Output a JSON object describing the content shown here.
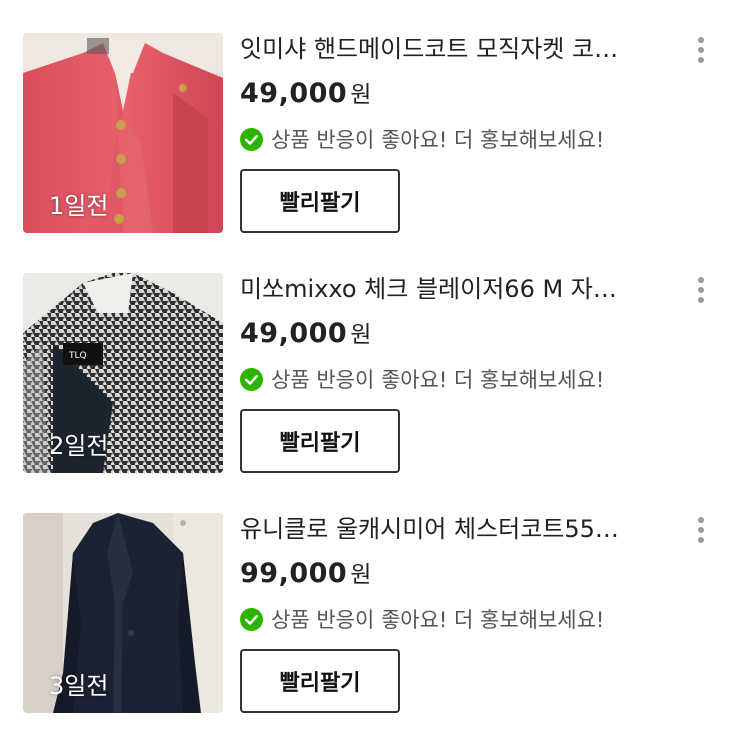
{
  "products": [
    {
      "title": "잇미샤 핸드메이드코트 모직자켓 코…",
      "price": "49,000",
      "currency": "원",
      "posted": "1일전",
      "status": "상품 반응이 좋아요! 더 홍보해보세요!",
      "action_label": "빨리팔기",
      "thumbnail": "pink-coat-photo"
    },
    {
      "title": "미쏘mixxo 체크 블레이저66 M 자…",
      "price": "49,000",
      "currency": "원",
      "posted": "2일전",
      "status": "상품 반응이 좋아요! 더 홍보해보세요!",
      "action_label": "빨리팔기",
      "thumbnail": "houndstooth-blazer-photo"
    },
    {
      "title": "유니클로 울캐시미어 체스터코트55…",
      "price": "99,000",
      "currency": "원",
      "posted": "3일전",
      "status": "상품 반응이 좋아요! 더 홍보해보세요!",
      "action_label": "빨리팔기",
      "thumbnail": "navy-coat-photo"
    }
  ],
  "colors": {
    "check_green": "#2DB400",
    "text_primary": "#222222",
    "text_secondary": "#555555",
    "more_dots": "#9A9A9A"
  },
  "icons": {
    "status": "check-circle-icon",
    "more": "more-vertical-icon"
  }
}
